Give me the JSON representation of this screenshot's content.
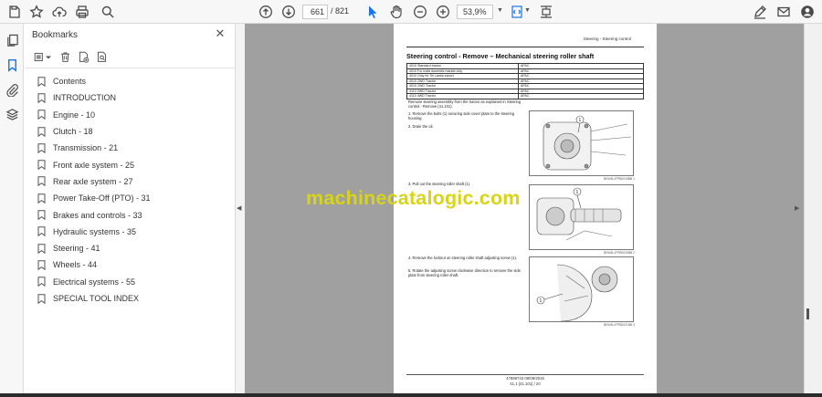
{
  "toolbar": {
    "current_page": "661",
    "page_separator": "/",
    "total_pages": "821",
    "zoom": "53,9%"
  },
  "bookmarks": {
    "title": "Bookmarks",
    "items": [
      "Contents",
      "INTRODUCTION",
      "Engine - 10",
      "Clutch - 18",
      "Transmission - 21",
      "Front axle system - 25",
      "Rear axle system - 27",
      "Power Take-Off (PTO) - 31",
      "Brakes and controls - 33",
      "Hydraulic systems - 35",
      "Steering - 41",
      "Wheels - 44",
      "Electrical systems - 55",
      "SPECIAL TOOL INDEX"
    ]
  },
  "document": {
    "header": "Steering - Steering control",
    "title": "Steering control - Remove – Mechanical steering roller shaft",
    "table": [
      [
        "4010 Standard tractor",
        "APAC"
      ],
      [
        "4010 For India domestic market only",
        "APAC"
      ],
      [
        "4010 Only for Sri Lanka export",
        "APAC"
      ],
      [
        "4010 2WD Tractor",
        "APAC"
      ],
      [
        "4010 2WD Tractor",
        "APAC"
      ],
      [
        "4110 2WD Tractor",
        "APAC"
      ],
      [
        "4110 4WD Tractor",
        "APAC"
      ]
    ],
    "intro": "Remove steering assembly from the tractor as explained in Steering control - Remove (41.101).",
    "step1": "1. Remove the bolts (1) securing side cover plate to the steering housing.",
    "step2": "2. Drain the oil.",
    "step3": "3. Pull out the steering roller shaft (1).",
    "step4": "4. Remove the locknut on steering roller shaft adjusting screw (1).",
    "step5": "5. Rotate the adjusting screw clockwise direction to remove the side plate from steering roller shaft.",
    "fig1_caption": "BRAIN-4TPB0019BB   1",
    "fig2_caption": "BRAIN-4TPB0020BB   2",
    "fig3_caption": "BRAIN-4TPB0021BB   3",
    "footer_line1": "47899743 09/09/2015",
    "footer_line2": "41.1 [41.101] / 20"
  },
  "watermark": "machinecatalogic.com",
  "colors": {
    "viewer_bg": "#a0a0a0",
    "accent": "#1a73e8",
    "watermark": "#d8d417"
  }
}
